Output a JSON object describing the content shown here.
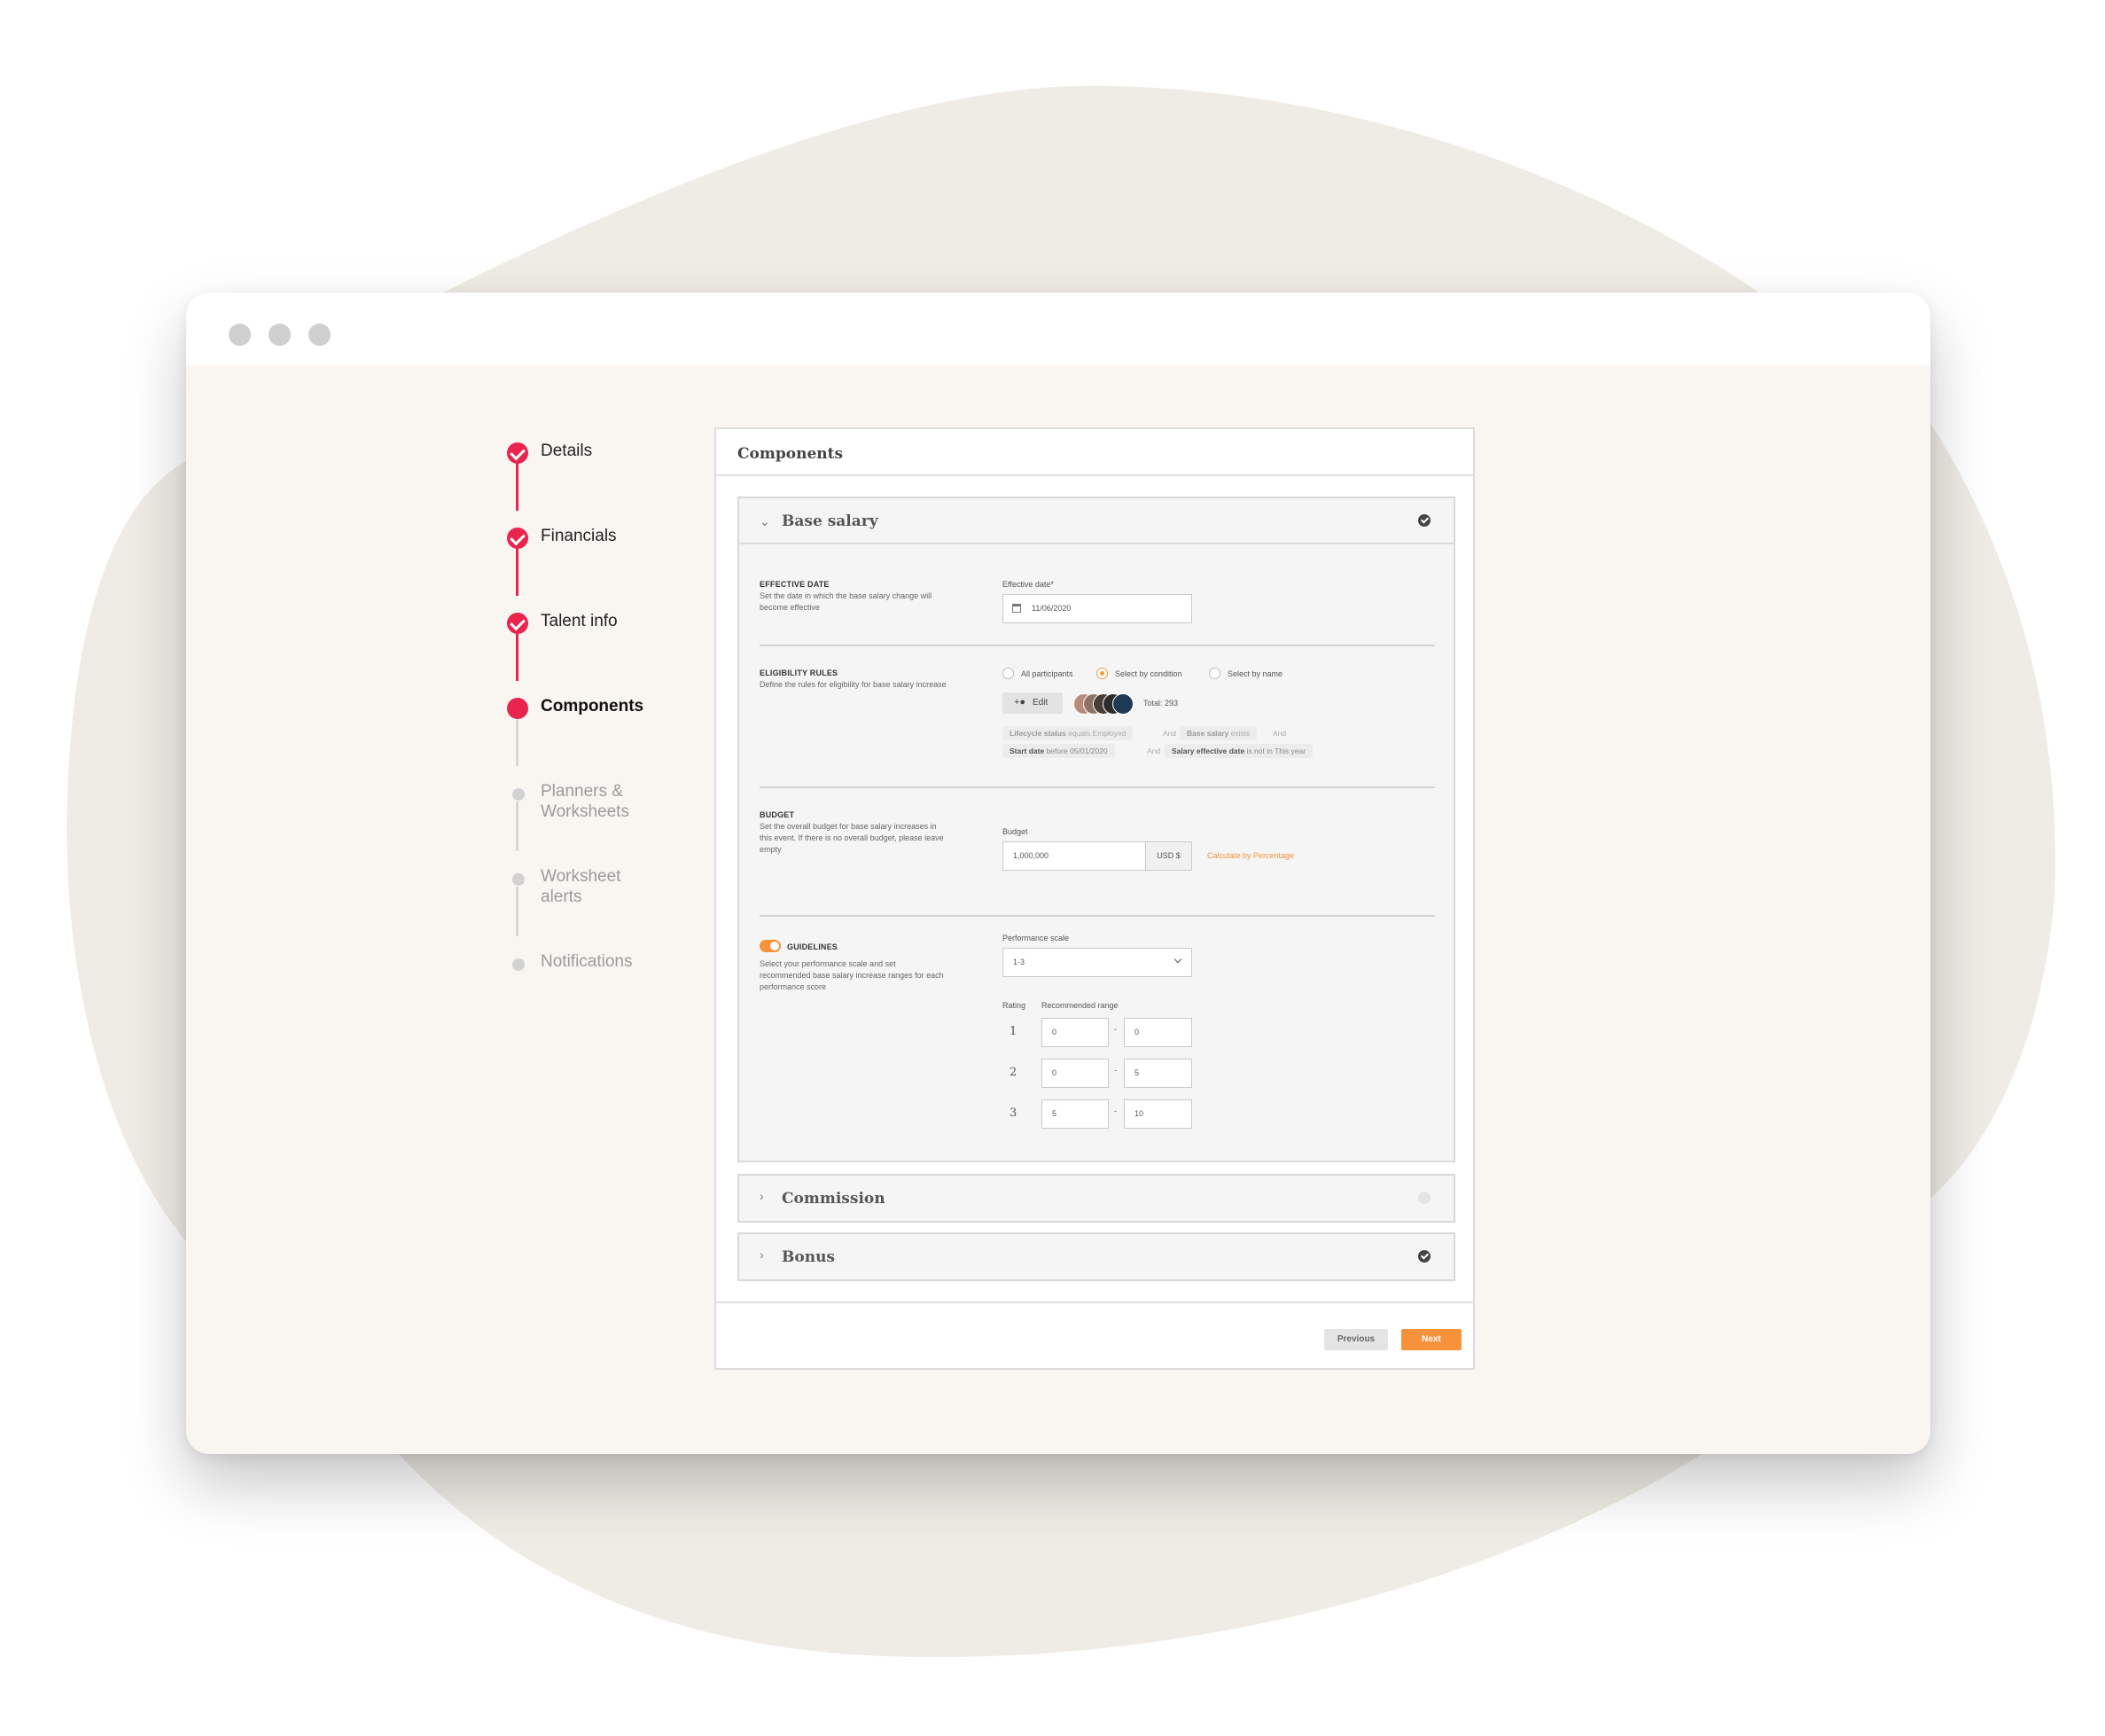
{
  "stepper": [
    {
      "label": "Details",
      "state": "done"
    },
    {
      "label": "Financials",
      "state": "done"
    },
    {
      "label": "Talent info",
      "state": "done"
    },
    {
      "label": "Components",
      "state": "active"
    },
    {
      "label": "Planners & Worksheets",
      "state": "todo"
    },
    {
      "label": "Worksheet alerts",
      "state": "todo"
    },
    {
      "label": "Notifications",
      "state": "todo"
    }
  ],
  "card": {
    "title": "Components",
    "base_salary": {
      "title": "Base salary",
      "status": "complete",
      "effective_date": {
        "section_title": "EFFECTIVE DATE",
        "description": "Set the date in which the base salary change will become effective",
        "field_label": "Effective date*",
        "value": "11/06/2020"
      },
      "eligibility": {
        "section_title": "ELIGIBILITY RULES",
        "description": "Define the rules for eligibility for base salary increase",
        "options": [
          "All participants",
          "Select by condition",
          "Select by name"
        ],
        "selected": "Select by condition",
        "edit_label": "Edit",
        "total": "Total: 293",
        "conditions": {
          "c1_field": "Lifecycle status",
          "c1_rest": " equals Employed",
          "c2_field": "Base salary",
          "c2_rest": " exists",
          "c3_field": "Start date",
          "c3_rest": " before 05/01/2020",
          "c4_field": "Salary effective date",
          "c4_rest": " is not in This year",
          "and": "And"
        }
      },
      "budget": {
        "section_title": "BUDGET",
        "description": "Set the overall budget for base salary increases in this event. If there is no overall budget, please leave empty",
        "field_label": "Budget",
        "value": "1,000,000",
        "currency": "USD $",
        "calc_link": "Calculate by Percentage"
      },
      "guidelines": {
        "section_title": "GUIDELINES",
        "enabled": true,
        "description": "Select your performance scale and set recommended base salary increase ranges for each performance score",
        "scale_label": "Performance scale",
        "scale_value": "1-3",
        "rating_header": "Rating",
        "range_header": "Recommended range",
        "dash": "-",
        "rows": [
          {
            "rating": "1",
            "min": "0",
            "max": "0"
          },
          {
            "rating": "2",
            "min": "0",
            "max": "5"
          },
          {
            "rating": "3",
            "min": "5",
            "max": "10"
          }
        ]
      }
    },
    "commission": {
      "title": "Commission",
      "status": "pending"
    },
    "bonus": {
      "title": "Bonus",
      "status": "complete"
    },
    "buttons": {
      "previous": "Previous",
      "next": "Next"
    }
  },
  "colors": {
    "accent_red": "#e8244f",
    "accent_orange": "#f7913a",
    "window_bg": "#f9f6f2",
    "blob": "#efebe5"
  },
  "icons": [
    "check-icon",
    "chevron-down-icon",
    "chevron-right-icon",
    "calendar-icon",
    "add-user-icon",
    "dropdown-chevron-icon"
  ]
}
